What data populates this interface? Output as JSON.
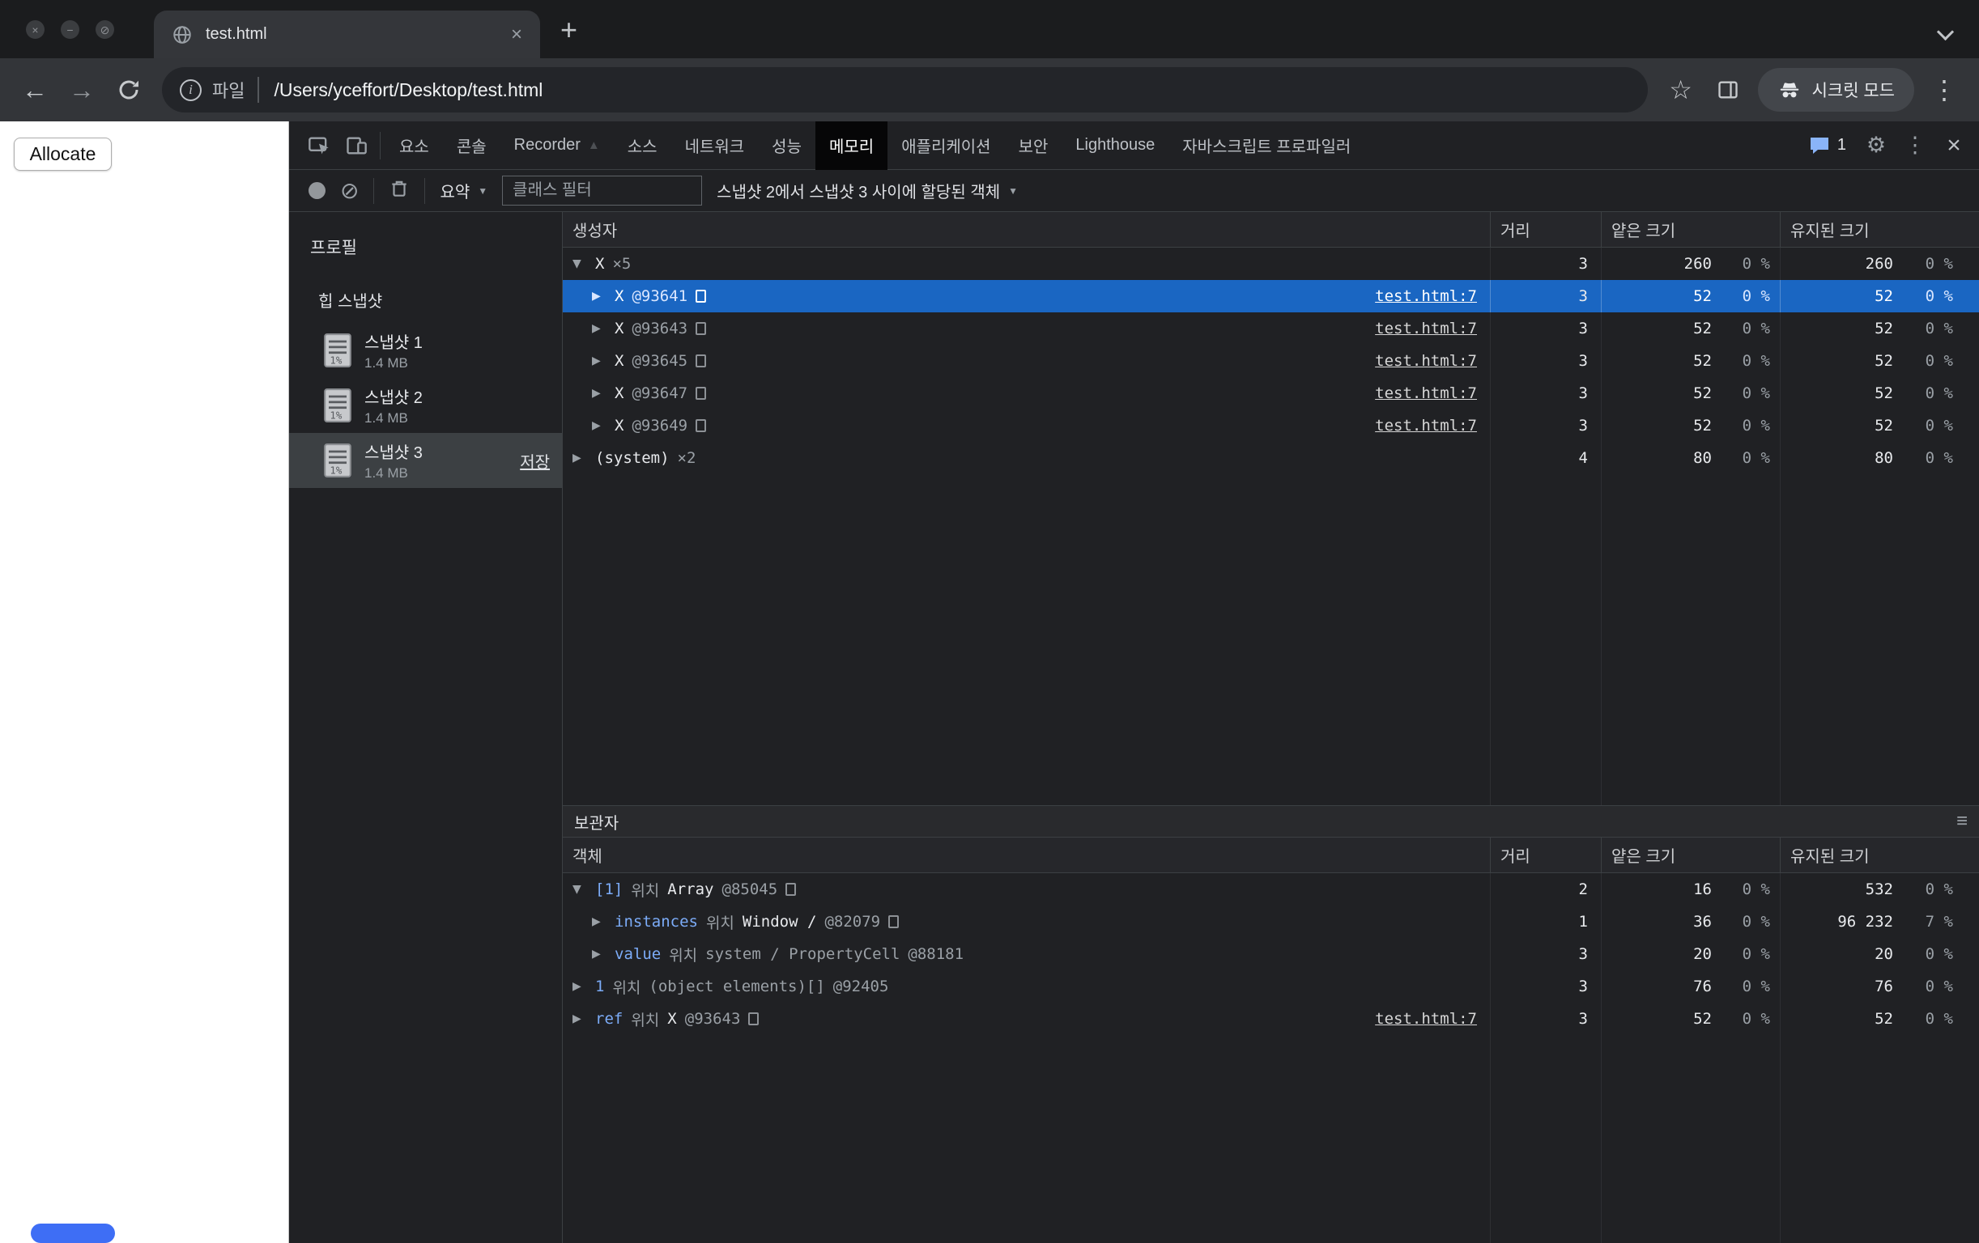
{
  "colors": {
    "selection": "#1a66c2",
    "property": "#7cacf8",
    "muted": "#9aa0a6",
    "text": "#e8eaed",
    "link": "#d6d6d6",
    "artifact": "#3e6ef5"
  },
  "icons": {
    "window_close": "×",
    "window_minimize": "−",
    "window_zoom": "⊘",
    "tab_close": "×",
    "new_tab": "+",
    "back": "←",
    "forward": "→",
    "star": "☆",
    "menu_dots": "⋮",
    "gear": "⚙",
    "devtools_close": "×",
    "clear": "⊘",
    "hamburger": "≡",
    "caret_down": "▼",
    "recorder_badge": "▲",
    "info": "i"
  },
  "browser": {
    "tab_title": "test.html",
    "url_scheme_label": "파일",
    "url_path": "/Users/yceffort/Desktop/test.html",
    "incognito_label": "시크릿 모드"
  },
  "page": {
    "allocate_label": "Allocate"
  },
  "devtools": {
    "selected_tab": "메모리",
    "issues_count": "1",
    "tabs": [
      {
        "id": "elements",
        "label": "요소"
      },
      {
        "id": "console",
        "label": "콘솔"
      },
      {
        "id": "recorder",
        "label": "Recorder",
        "badge": true
      },
      {
        "id": "sources",
        "label": "소스"
      },
      {
        "id": "network",
        "label": "네트워크"
      },
      {
        "id": "performance",
        "label": "성능"
      },
      {
        "id": "memory",
        "label": "메모리"
      },
      {
        "id": "application",
        "label": "애플리케이션"
      },
      {
        "id": "security",
        "label": "보안"
      },
      {
        "id": "lighthouse",
        "label": "Lighthouse"
      },
      {
        "id": "javascript-profiler",
        "label": "자바스크립트 프로파일러"
      }
    ],
    "toolbar": {
      "summary_label": "요약",
      "filter_placeholder": "클래스 필터",
      "range_label": "스냅샷 2에서 스냅샷 3 사이에 할당된 객체"
    },
    "sidebar": {
      "profiles_label": "프로필",
      "heap_label": "힙 스냅샷",
      "snapshots": [
        {
          "name": "스냅샷 1",
          "size": "1.4 MB",
          "selected": false
        },
        {
          "name": "스냅샷 2",
          "size": "1.4 MB",
          "selected": false
        },
        {
          "name": "스냅샷 3",
          "size": "1.4 MB",
          "selected": true,
          "action": "저장"
        }
      ]
    },
    "constructors": {
      "columns": [
        "생성자",
        "거리",
        "얕은 크기",
        "유지된 크기"
      ],
      "rows": [
        {
          "level": 0,
          "expander": "▼",
          "name": "X",
          "count": "×5",
          "distance": "3",
          "shallow": "260",
          "shallow_pct": "0 %",
          "retained": "260",
          "retained_pct": "0 %",
          "selected": false
        },
        {
          "level": 1,
          "expander": "▶",
          "name": "X",
          "id": "@93641",
          "icon": true,
          "link": "test.html:7",
          "distance": "3",
          "shallow": "52",
          "shallow_pct": "0 %",
          "retained": "52",
          "retained_pct": "0 %",
          "selected": true
        },
        {
          "level": 1,
          "expander": "▶",
          "name": "X",
          "id": "@93643",
          "icon": true,
          "link": "test.html:7",
          "distance": "3",
          "shallow": "52",
          "shallow_pct": "0 %",
          "retained": "52",
          "retained_pct": "0 %",
          "selected": false
        },
        {
          "level": 1,
          "expander": "▶",
          "name": "X",
          "id": "@93645",
          "icon": true,
          "link": "test.html:7",
          "distance": "3",
          "shallow": "52",
          "shallow_pct": "0 %",
          "retained": "52",
          "retained_pct": "0 %",
          "selected": false
        },
        {
          "level": 1,
          "expander": "▶",
          "name": "X",
          "id": "@93647",
          "icon": true,
          "link": "test.html:7",
          "distance": "3",
          "shallow": "52",
          "shallow_pct": "0 %",
          "retained": "52",
          "retained_pct": "0 %",
          "selected": false
        },
        {
          "level": 1,
          "expander": "▶",
          "name": "X",
          "id": "@93649",
          "icon": true,
          "link": "test.html:7",
          "distance": "3",
          "shallow": "52",
          "shallow_pct": "0 %",
          "retained": "52",
          "retained_pct": "0 %",
          "selected": false
        },
        {
          "level": 0,
          "expander": "▶",
          "name": "(system)",
          "count": "×2",
          "distance": "4",
          "shallow": "80",
          "shallow_pct": "0 %",
          "retained": "80",
          "retained_pct": "0 %",
          "selected": false
        }
      ]
    },
    "retainers": {
      "title": "보관자",
      "location_label": "위치",
      "columns": [
        "객체",
        "거리",
        "얕은 크기",
        "유지된 크기"
      ],
      "rows": [
        {
          "level": 0,
          "expander": "▼",
          "prop": "[1]",
          "obj": "Array",
          "at": "@85045",
          "icon": true,
          "distance": "2",
          "shallow": "16",
          "shallow_pct": "0 %",
          "retained": "532",
          "retained_pct": "0 %"
        },
        {
          "level": 1,
          "expander": "▶",
          "prop": "instances",
          "obj": "Window /",
          "at": "@82079",
          "icon": true,
          "distance": "1",
          "shallow": "36",
          "shallow_pct": "0 %",
          "retained": "96 232",
          "retained_pct": "7 %"
        },
        {
          "level": 1,
          "expander": "▶",
          "prop": "value",
          "obj": "system / PropertyCell",
          "dim": true,
          "at": "@88181",
          "distance": "3",
          "shallow": "20",
          "shallow_pct": "0 %",
          "retained": "20",
          "retained_pct": "0 %"
        },
        {
          "level": 0,
          "expander": "▶",
          "prop": "1",
          "obj": "(object elements)[]",
          "dim": true,
          "at": "@92405",
          "distance": "3",
          "shallow": "76",
          "shallow_pct": "0 %",
          "retained": "76",
          "retained_pct": "0 %"
        },
        {
          "level": 0,
          "expander": "▶",
          "prop": "ref",
          "obj": "X",
          "at": "@93643",
          "icon": true,
          "link": "test.html:7",
          "distance": "3",
          "shallow": "52",
          "shallow_pct": "0 %",
          "retained": "52",
          "retained_pct": "0 %"
        }
      ]
    }
  }
}
